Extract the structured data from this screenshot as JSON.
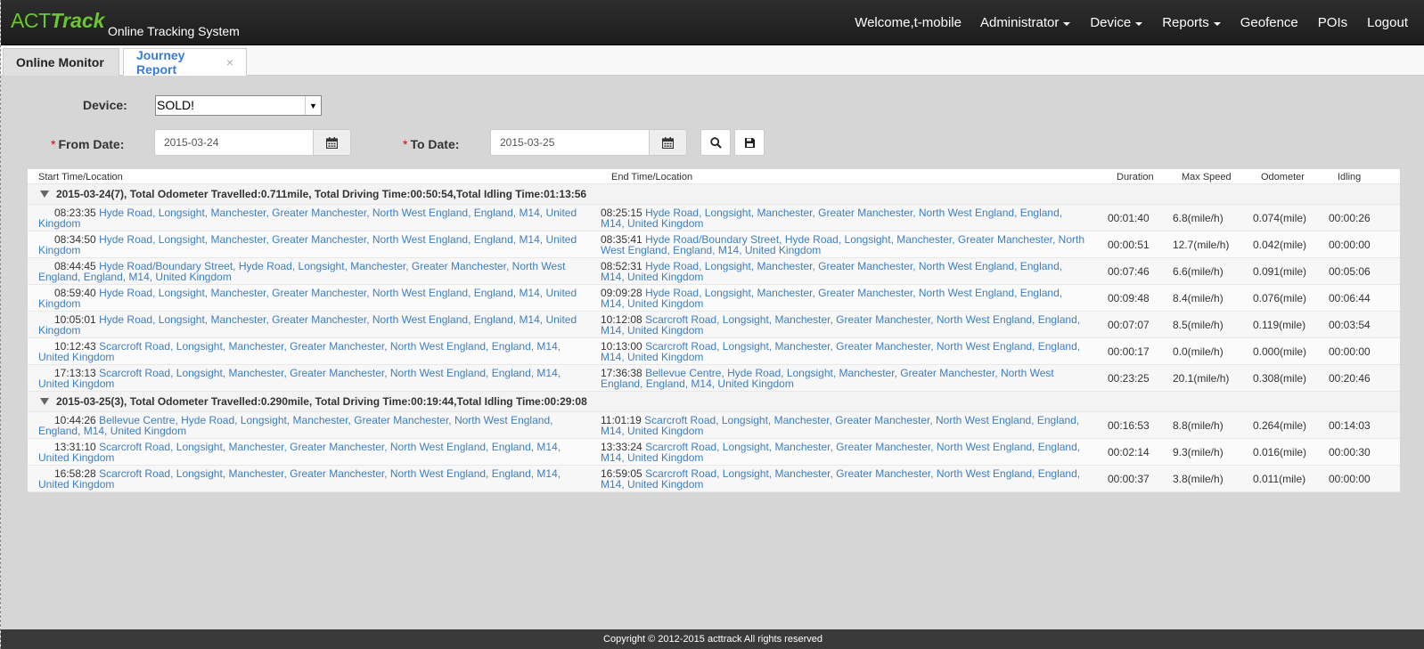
{
  "brand": {
    "act": "ACT",
    "track": "Track",
    "subtitle": "Online Tracking System"
  },
  "nav": {
    "welcome": "Welcome,t-mobile",
    "administrator": "Administrator",
    "device": "Device",
    "reports": "Reports",
    "geofence": "Geofence",
    "pois": "POIs",
    "logout": "Logout"
  },
  "tabs": {
    "online_monitor": "Online Monitor",
    "journey_report": "Journey Report",
    "close": "×"
  },
  "form": {
    "device_label": "Device:",
    "device_value": "SOLD!",
    "required_mark": "*",
    "from_label": "From Date:",
    "from_value": "2015-03-24",
    "to_label": "To Date:",
    "to_value": "2015-03-25"
  },
  "icons": {
    "calendar": "calendar-icon",
    "search": "search-icon",
    "save": "save-icon",
    "expand": "triangle-down-icon"
  },
  "table": {
    "headers": {
      "start": "Start Time/Location",
      "end": "End Time/Location",
      "duration": "Duration",
      "max_speed": "Max Speed",
      "odometer": "Odometer",
      "idling": "Idling"
    },
    "groups": [
      {
        "summary": "2015-03-24(7), Total Odometer Travelled:0.711mile, Total Driving Time:00:50:54,Total Idling Time:01:13:56",
        "rows": [
          {
            "start_time": "08:23:35",
            "start_loc": "Hyde Road, Longsight, Manchester, Greater Manchester, North West England, England, M14, United Kingdom",
            "end_time": "08:25:15",
            "end_loc": "Hyde Road, Longsight, Manchester, Greater Manchester, North West England, England, M14, United Kingdom",
            "duration": "00:01:40",
            "max_speed": "6.8(mile/h)",
            "odometer": "0.074(mile)",
            "idling": "00:00:26"
          },
          {
            "start_time": "08:34:50",
            "start_loc": "Hyde Road, Longsight, Manchester, Greater Manchester, North West England, England, M14, United Kingdom",
            "end_time": "08:35:41",
            "end_loc": "Hyde Road/Boundary Street, Hyde Road, Longsight, Manchester, Greater Manchester, North West England, England, M14, United Kingdom",
            "duration": "00:00:51",
            "max_speed": "12.7(mile/h)",
            "odometer": "0.042(mile)",
            "idling": "00:00:00"
          },
          {
            "start_time": "08:44:45",
            "start_loc": "Hyde Road/Boundary Street, Hyde Road, Longsight, Manchester, Greater Manchester, North West England, England, M14, United Kingdom",
            "end_time": "08:52:31",
            "end_loc": "Hyde Road, Longsight, Manchester, Greater Manchester, North West England, England, M14, United Kingdom",
            "duration": "00:07:46",
            "max_speed": "6.6(mile/h)",
            "odometer": "0.091(mile)",
            "idling": "00:05:06"
          },
          {
            "start_time": "08:59:40",
            "start_loc": "Hyde Road, Longsight, Manchester, Greater Manchester, North West England, England, M14, United Kingdom",
            "end_time": "09:09:28",
            "end_loc": "Hyde Road, Longsight, Manchester, Greater Manchester, North West England, England, M14, United Kingdom",
            "duration": "00:09:48",
            "max_speed": "8.4(mile/h)",
            "odometer": "0.076(mile)",
            "idling": "00:06:44"
          },
          {
            "start_time": "10:05:01",
            "start_loc": "Hyde Road, Longsight, Manchester, Greater Manchester, North West England, England, M14, United Kingdom",
            "end_time": "10:12:08",
            "end_loc": "Scarcroft Road, Longsight, Manchester, Greater Manchester, North West England, England, M14, United Kingdom",
            "duration": "00:07:07",
            "max_speed": "8.5(mile/h)",
            "odometer": "0.119(mile)",
            "idling": "00:03:54"
          },
          {
            "start_time": "10:12:43",
            "start_loc": "Scarcroft Road, Longsight, Manchester, Greater Manchester, North West England, England, M14, United Kingdom",
            "end_time": "10:13:00",
            "end_loc": "Scarcroft Road, Longsight, Manchester, Greater Manchester, North West England, England, M14, United Kingdom",
            "duration": "00:00:17",
            "max_speed": "0.0(mile/h)",
            "odometer": "0.000(mile)",
            "idling": "00:00:00"
          },
          {
            "start_time": "17:13:13",
            "start_loc": "Scarcroft Road, Longsight, Manchester, Greater Manchester, North West England, England, M14, United Kingdom",
            "end_time": "17:36:38",
            "end_loc": "Bellevue Centre, Hyde Road, Longsight, Manchester, Greater Manchester, North West England, England, M14, United Kingdom",
            "duration": "00:23:25",
            "max_speed": "20.1(mile/h)",
            "odometer": "0.308(mile)",
            "idling": "00:20:46"
          }
        ]
      },
      {
        "summary": "2015-03-25(3), Total Odometer Travelled:0.290mile, Total Driving Time:00:19:44,Total Idling Time:00:29:08",
        "rows": [
          {
            "start_time": "10:44:26",
            "start_loc": "Bellevue Centre, Hyde Road, Longsight, Manchester, Greater Manchester, North West England, England, M14, United Kingdom",
            "end_time": "11:01:19",
            "end_loc": "Scarcroft Road, Longsight, Manchester, Greater Manchester, North West England, England, M14, United Kingdom",
            "duration": "00:16:53",
            "max_speed": "8.8(mile/h)",
            "odometer": "0.264(mile)",
            "idling": "00:14:03"
          },
          {
            "start_time": "13:31:10",
            "start_loc": "Scarcroft Road, Longsight, Manchester, Greater Manchester, North West England, England, M14, United Kingdom",
            "end_time": "13:33:24",
            "end_loc": "Scarcroft Road, Longsight, Manchester, Greater Manchester, North West England, England, M14, United Kingdom",
            "duration": "00:02:14",
            "max_speed": "9.3(mile/h)",
            "odometer": "0.016(mile)",
            "idling": "00:00:30"
          },
          {
            "start_time": "16:58:28",
            "start_loc": "Scarcroft Road, Longsight, Manchester, Greater Manchester, North West England, England, M14, United Kingdom",
            "end_time": "16:59:05",
            "end_loc": "Scarcroft Road, Longsight, Manchester, Greater Manchester, North West England, England, M14, United Kingdom",
            "duration": "00:00:37",
            "max_speed": "3.8(mile/h)",
            "odometer": "0.011(mile)",
            "idling": "00:00:00"
          }
        ]
      }
    ]
  },
  "footer": {
    "copyright": "Copyright © 2012-2015 acttrack All rights reserved"
  },
  "colors": {
    "brand_green": "#6cc62f",
    "link_blue": "#3d7ec2",
    "tab_active": "#3a7bd5",
    "navbar": "#222222"
  }
}
